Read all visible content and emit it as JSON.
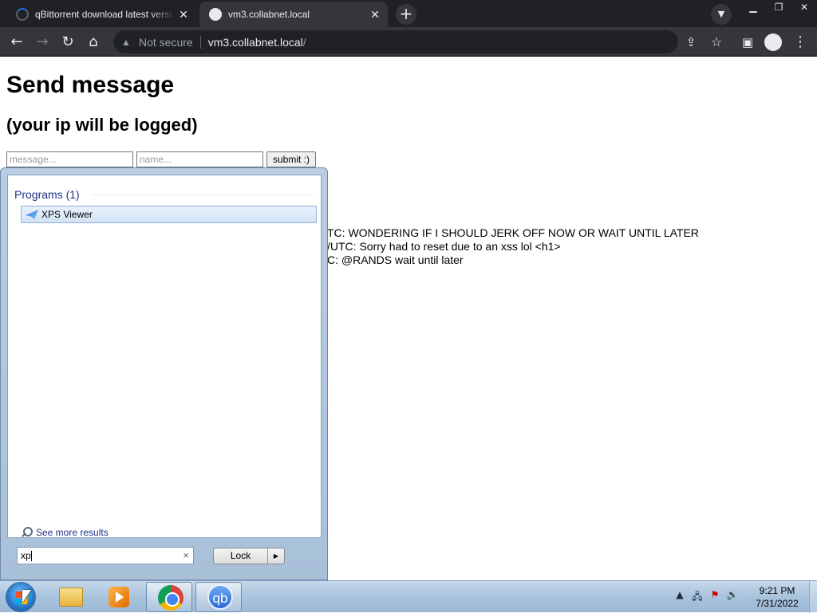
{
  "browser": {
    "tabs": [
      {
        "title": "qBittorrent download latest versi",
        "active": false
      },
      {
        "title": "vm3.collabnet.local",
        "active": true
      }
    ],
    "new_tab": "+",
    "tab_close": "✕",
    "address": {
      "security": "Not secure",
      "host": "vm3.collabnet.local",
      "path": "/"
    }
  },
  "page": {
    "heading": "Send message",
    "subheading": "(your ip will be logged)",
    "form": {
      "message_placeholder": "message...",
      "name_placeholder": "name...",
      "submit_label": "submit :)"
    },
    "messages": [
      "TC: WONDERING IF I SHOULD JERK OFF NOW OR WAIT UNTIL LATER",
      "/UTC: Sorry had to reset due to an xss lol <h1>",
      "C: @RANDS wait until later"
    ]
  },
  "start_menu": {
    "group_label": "Programs (1)",
    "results": [
      {
        "label": "XPS Viewer",
        "icon": "xps-viewer-icon"
      }
    ],
    "see_more": "See more results",
    "search_value": "xp",
    "clear_glyph": "×",
    "power_button": "Lock"
  },
  "taskbar": {
    "apps": [
      "windows-explorer",
      "windows-media-player",
      "google-chrome",
      "qbittorrent"
    ],
    "qb_label": "qb",
    "clock_time": "9:21 PM",
    "clock_date": "7/31/2022"
  }
}
